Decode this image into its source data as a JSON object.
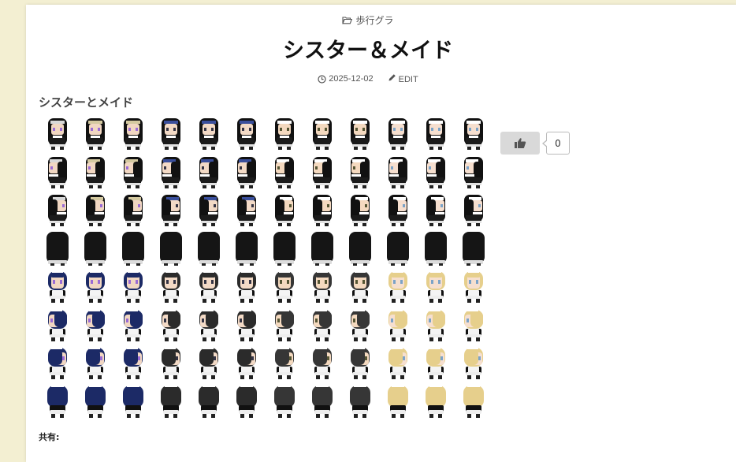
{
  "category": {
    "icon": "folder-open-icon",
    "label": "歩行グラ"
  },
  "post": {
    "title": "シスター＆メイド",
    "date_icon": "clock-icon",
    "date": "2025-12-02",
    "edit_icon": "pencil-icon",
    "edit_label": "EDIT"
  },
  "content": {
    "heading": "シスターとメイド",
    "sprite_sheet": {
      "columns": 12,
      "rows": [
        "front",
        "left",
        "right",
        "back",
        "front",
        "left",
        "right",
        "back"
      ],
      "row_groups": [
        "nun",
        "nun",
        "nun",
        "nun",
        "maid",
        "maid",
        "maid",
        "maid"
      ],
      "column_sets": [
        {
          "skin": "#f1d7c2",
          "eye": "#9a6bd6",
          "band": "#d8d8d8",
          "hair": "#1c2a66"
        },
        {
          "skin": "#f1d7c2",
          "eye": "#9a6bd6",
          "band": "#d4c9a0",
          "hair": "#1c2a66"
        },
        {
          "skin": "#f1d7c2",
          "eye": "#9a6bd6",
          "band": "#d4c9a0",
          "hair": "#1c2a66"
        },
        {
          "skin": "#f3dac6",
          "eye": "#334",
          "band": "#3a4f9c",
          "hair": "#2b2b2b"
        },
        {
          "skin": "#f3dac6",
          "eye": "#334",
          "band": "#3a4f9c",
          "hair": "#2b2b2b"
        },
        {
          "skin": "#f3dac6",
          "eye": "#334",
          "band": "#3a4f9c",
          "hair": "#2b2b2b"
        },
        {
          "skin": "#f4d9bf",
          "eye": "#553",
          "band": "#ffffff",
          "hair": "#363636"
        },
        {
          "skin": "#f4d9bf",
          "eye": "#553",
          "band": "#ffffff",
          "hair": "#363636"
        },
        {
          "skin": "#f4d9bf",
          "eye": "#553",
          "band": "#ffffff",
          "hair": "#363636"
        },
        {
          "skin": "#f6dfcf",
          "eye": "#7ba3c8",
          "band": "#ffffff",
          "hair": "#e6cf8c"
        },
        {
          "skin": "#f6dfcf",
          "eye": "#7ba3c8",
          "band": "#ffffff",
          "hair": "#e6cf8c"
        },
        {
          "skin": "#f6dfcf",
          "eye": "#7ba3c8",
          "band": "#ffffff",
          "hair": "#e6cf8c"
        }
      ]
    }
  },
  "like": {
    "icon": "thumbs-up-icon",
    "count": "0"
  },
  "share_label": "共有:"
}
